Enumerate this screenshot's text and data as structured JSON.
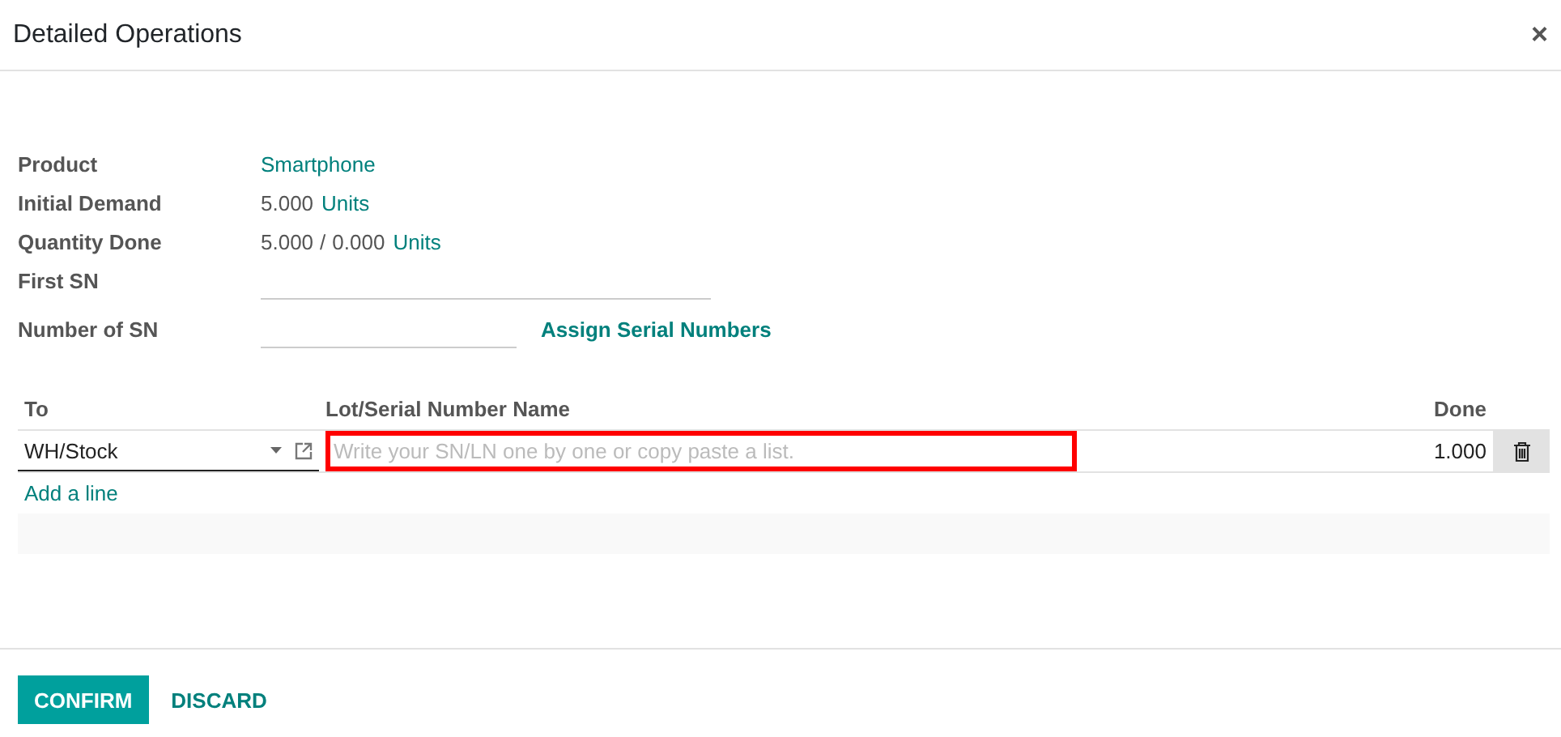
{
  "dialog": {
    "title": "Detailed Operations",
    "close": "×"
  },
  "fields": [
    {
      "label": "Product",
      "kind": "link",
      "value": "Smartphone"
    },
    {
      "label": "Initial Demand",
      "kind": "quantity",
      "value": "5.000",
      "unit": "Units"
    },
    {
      "label": "Quantity Done",
      "kind": "ratio",
      "value": "5.000",
      "separator": "/",
      "total": "0.000",
      "unit": "Units"
    },
    {
      "label": "First SN",
      "kind": "input"
    },
    {
      "label": "Number of SN",
      "kind": "input_action",
      "action": "Assign Serial Numbers"
    }
  ],
  "table": {
    "columns": [
      "To",
      "Lot/Serial Number Name",
      "Done"
    ],
    "rows": [
      {
        "location": "WH/Stock",
        "lot_placeholder": "Write your SN/LN one by one or copy paste a list.",
        "lot_highlighted": true,
        "done": "1.000"
      }
    ],
    "add_line": "Add a line"
  },
  "buttons": [
    {
      "label": "CONFIRM",
      "primary": true
    },
    {
      "label": "DISCARD",
      "primary": false
    }
  ]
}
